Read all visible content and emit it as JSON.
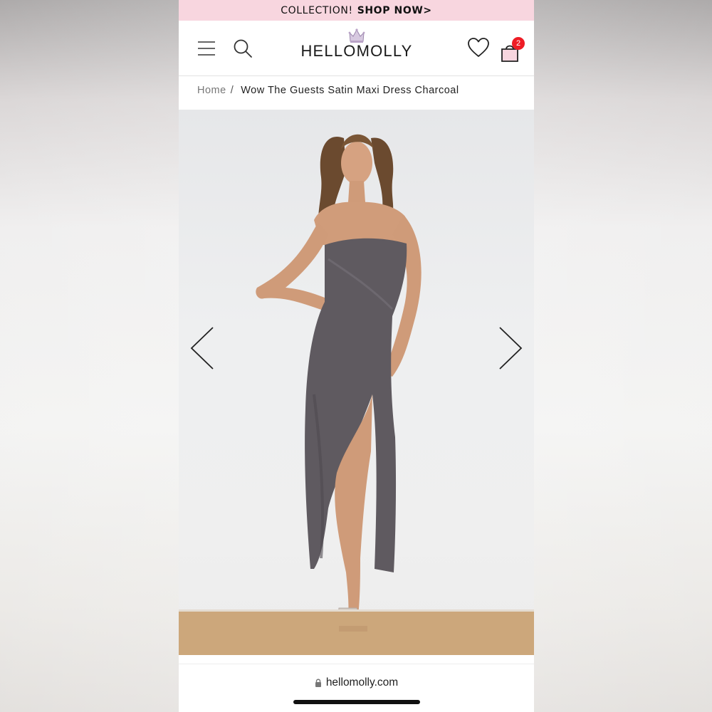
{
  "promo": {
    "text": "COLLECTION!",
    "cta": "SHOP NOW>"
  },
  "header": {
    "logo_text": "HELLOMOLLY",
    "cart_count": "2",
    "icons": [
      "menu-icon",
      "search-icon",
      "heart-icon",
      "shopping-bag-icon"
    ]
  },
  "breadcrumb": {
    "home": "Home",
    "separator": "/",
    "current": "Wow The Guests Satin Maxi Dress Charcoal"
  },
  "gallery": {
    "image_alt": "Model wearing strapless charcoal satin maxi dress",
    "prev_icon": "chevron-left-icon",
    "next_icon": "chevron-right-icon"
  },
  "browser": {
    "url": "hellomolly.com"
  },
  "colors": {
    "promo_bg": "#f8d6df",
    "badge": "#ee1c25",
    "dress": "#5f5a60",
    "crown": "#b9a2c6"
  }
}
